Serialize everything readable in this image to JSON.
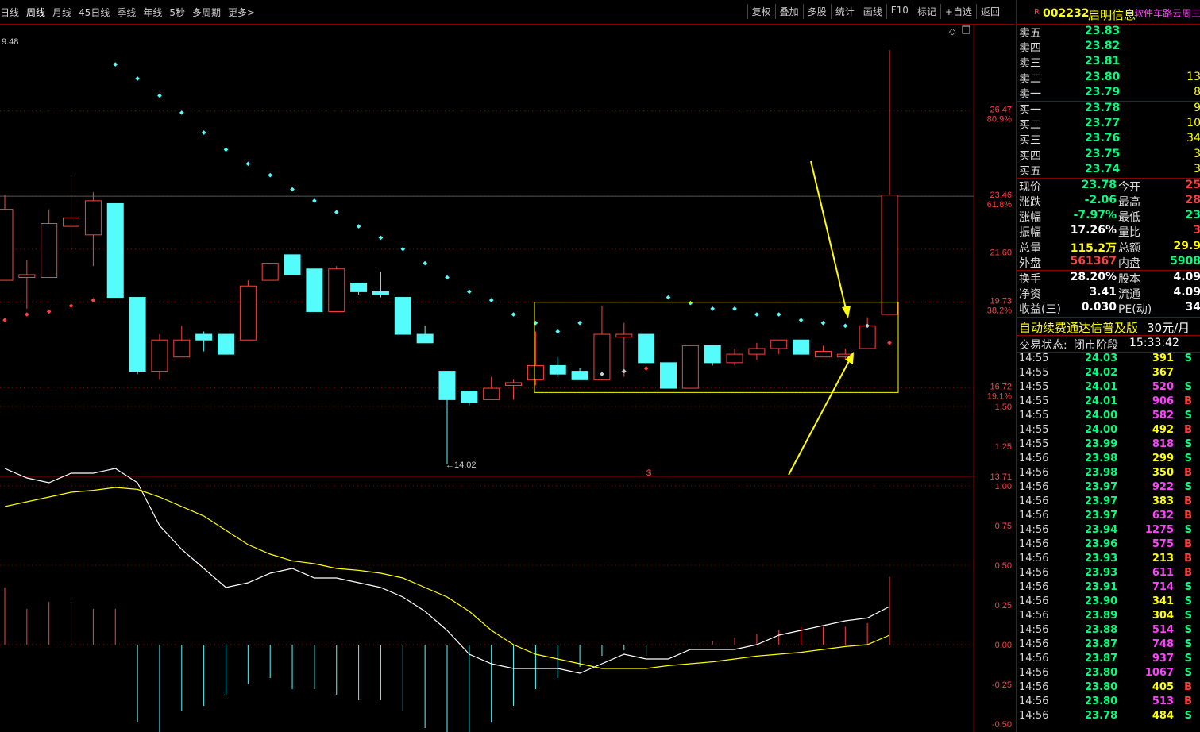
{
  "toolbar": {
    "periods": [
      "日线",
      "周线",
      "月线",
      "45日线",
      "季线",
      "年线",
      "5秒",
      "多周期",
      "更多>"
    ],
    "active_period": "周线",
    "actions": [
      "复权",
      "叠加",
      "多股",
      "统计",
      "画线",
      "F10",
      "标记",
      "+自选",
      "返回"
    ]
  },
  "chart_data": {
    "type": "candlestick",
    "price_axis_labels": [
      "26.47",
      "80.9%",
      "23.46",
      "61.8%",
      "21.60",
      "19.73",
      "38.2%",
      "16.72",
      "19.1%",
      "13.71"
    ],
    "top_left_label": "9.48",
    "low_marker": "14.02",
    "marker_symbol": "$",
    "macd_axis_labels": [
      "1.50",
      "1.25",
      "1.00",
      "0.75",
      "0.50",
      "0.25",
      "0.00",
      "-0.25",
      "-0.50"
    ],
    "candles": [
      {
        "o": 20.5,
        "h": 23.5,
        "l": 20.5,
        "c": 23.0
      },
      {
        "o": 20.6,
        "h": 21.2,
        "l": 19.5,
        "c": 20.7
      },
      {
        "o": 20.6,
        "h": 23.0,
        "l": 20.6,
        "c": 22.5
      },
      {
        "o": 22.4,
        "h": 24.2,
        "l": 21.5,
        "c": 22.7
      },
      {
        "o": 22.1,
        "h": 23.6,
        "l": 21.0,
        "c": 23.3
      },
      {
        "o": 23.2,
        "h": 23.2,
        "l": 19.9,
        "c": 19.9
      },
      {
        "o": 19.9,
        "h": 19.9,
        "l": 17.2,
        "c": 17.3
      },
      {
        "o": 17.3,
        "h": 18.6,
        "l": 17.0,
        "c": 18.4
      },
      {
        "o": 17.8,
        "h": 18.9,
        "l": 17.8,
        "c": 18.4
      },
      {
        "o": 18.6,
        "h": 18.7,
        "l": 18.0,
        "c": 18.4
      },
      {
        "o": 18.6,
        "h": 18.6,
        "l": 17.9,
        "c": 17.9
      },
      {
        "o": 18.4,
        "h": 20.5,
        "l": 18.4,
        "c": 20.3
      },
      {
        "o": 20.5,
        "h": 21.1,
        "l": 20.5,
        "c": 21.1
      },
      {
        "o": 21.4,
        "h": 21.4,
        "l": 20.7,
        "c": 20.7
      },
      {
        "o": 20.9,
        "h": 20.9,
        "l": 19.4,
        "c": 19.4
      },
      {
        "o": 19.4,
        "h": 21.0,
        "l": 19.4,
        "c": 20.9
      },
      {
        "o": 20.4,
        "h": 20.4,
        "l": 20.0,
        "c": 20.1
      },
      {
        "o": 20.1,
        "h": 20.8,
        "l": 19.9,
        "c": 20.0
      },
      {
        "o": 19.9,
        "h": 19.9,
        "l": 18.6,
        "c": 18.6
      },
      {
        "o": 18.6,
        "h": 18.9,
        "l": 18.3,
        "c": 18.3
      },
      {
        "o": 17.3,
        "h": 17.3,
        "l": 14.02,
        "c": 16.3
      },
      {
        "o": 16.6,
        "h": 16.6,
        "l": 16.1,
        "c": 16.2
      },
      {
        "o": 16.3,
        "h": 17.1,
        "l": 16.3,
        "c": 16.7
      },
      {
        "o": 16.8,
        "h": 17.0,
        "l": 16.3,
        "c": 16.9
      },
      {
        "o": 17.0,
        "h": 18.7,
        "l": 16.8,
        "c": 17.5
      },
      {
        "o": 17.5,
        "h": 17.8,
        "l": 17.1,
        "c": 17.2
      },
      {
        "o": 17.3,
        "h": 17.4,
        "l": 17.0,
        "c": 17.0
      },
      {
        "o": 17.0,
        "h": 19.6,
        "l": 17.0,
        "c": 18.6
      },
      {
        "o": 18.5,
        "h": 19.0,
        "l": 17.1,
        "c": 18.6
      },
      {
        "o": 18.6,
        "h": 18.6,
        "l": 17.7,
        "c": 17.6
      },
      {
        "o": 17.6,
        "h": 17.6,
        "l": 16.7,
        "c": 16.7
      },
      {
        "o": 16.7,
        "h": 18.0,
        "l": 16.7,
        "c": 18.2
      },
      {
        "o": 18.2,
        "h": 18.2,
        "l": 17.5,
        "c": 17.6
      },
      {
        "o": 17.6,
        "h": 18.1,
        "l": 17.5,
        "c": 17.9
      },
      {
        "o": 17.9,
        "h": 18.3,
        "l": 17.7,
        "c": 18.1
      },
      {
        "o": 18.1,
        "h": 18.4,
        "l": 17.9,
        "c": 18.4
      },
      {
        "o": 18.4,
        "h": 18.3,
        "l": 17.9,
        "c": 17.9
      },
      {
        "o": 17.8,
        "h": 18.2,
        "l": 17.8,
        "c": 18.0
      },
      {
        "o": 17.8,
        "h": 18.1,
        "l": 17.7,
        "c": 17.9
      },
      {
        "o": 18.1,
        "h": 19.2,
        "l": 18.1,
        "c": 18.9
      },
      {
        "o": 19.3,
        "h": 28.6,
        "l": 19.3,
        "c": 23.5
      }
    ],
    "sar_dots": [
      {
        "i": 0,
        "v": 19.1
      },
      {
        "i": 1,
        "v": 19.3
      },
      {
        "i": 2,
        "v": 19.4
      },
      {
        "i": 3,
        "v": 19.6
      },
      {
        "i": 4,
        "v": 19.8
      },
      {
        "i": 5,
        "v": 28.1
      },
      {
        "i": 6,
        "v": 27.6
      },
      {
        "i": 7,
        "v": 27.0
      },
      {
        "i": 8,
        "v": 26.4
      },
      {
        "i": 9,
        "v": 25.7
      },
      {
        "i": 10,
        "v": 25.1
      },
      {
        "i": 11,
        "v": 24.6
      },
      {
        "i": 12,
        "v": 24.2
      },
      {
        "i": 13,
        "v": 23.7
      },
      {
        "i": 14,
        "v": 23.3
      },
      {
        "i": 15,
        "v": 22.9
      },
      {
        "i": 16,
        "v": 22.4
      },
      {
        "i": 17,
        "v": 22.0
      },
      {
        "i": 18,
        "v": 21.6
      },
      {
        "i": 19,
        "v": 21.1
      },
      {
        "i": 20,
        "v": 20.6
      },
      {
        "i": 21,
        "v": 20.1
      },
      {
        "i": 22,
        "v": 19.8
      },
      {
        "i": 23,
        "v": 19.3
      },
      {
        "i": 24,
        "v": 19.0
      },
      {
        "i": 25,
        "v": 18.7
      },
      {
        "i": 26,
        "v": 19.0
      },
      {
        "i": 27,
        "v": 17.2
      },
      {
        "i": 28,
        "v": 17.3
      },
      {
        "i": 29,
        "v": 17.4
      },
      {
        "i": 30,
        "v": 19.9
      },
      {
        "i": 31,
        "v": 19.7
      },
      {
        "i": 32,
        "v": 19.5
      },
      {
        "i": 33,
        "v": 19.5
      },
      {
        "i": 34,
        "v": 19.3
      },
      {
        "i": 35,
        "v": 19.3
      },
      {
        "i": 36,
        "v": 19.1
      },
      {
        "i": 37,
        "v": 19.0
      },
      {
        "i": 38,
        "v": 18.9
      },
      {
        "i": 39,
        "v": 18.9
      },
      {
        "i": 40,
        "v": 18.3
      }
    ],
    "macd_hist": [
      0.8,
      0.5,
      0.6,
      0.6,
      0.5,
      0.5,
      0.0,
      0.0,
      0.0,
      0.0,
      0.0,
      0.0,
      0.0,
      0.0,
      0.0,
      0.0,
      0.0,
      0.0,
      0.0,
      0.0,
      0.0,
      0.0,
      0.0,
      0.0,
      0.0,
      0.0,
      0.0,
      0.0,
      0.0,
      0.0,
      0.0,
      0.0,
      0.05,
      0.1,
      0.15,
      0.2,
      0.25,
      0.25,
      0.25,
      0.3,
      0.95
    ],
    "macd_hist_neg": [
      0,
      0,
      0,
      0,
      0,
      0,
      -0.7,
      -0.85,
      -0.6,
      -0.55,
      -0.45,
      -0.35,
      -0.3,
      -0.4,
      -0.4,
      -0.45,
      -0.5,
      -0.5,
      -0.6,
      -0.75,
      -0.9,
      -0.8,
      -0.7,
      -0.55,
      -0.4,
      -0.3,
      -0.2,
      -0.1,
      -0.05,
      -0.1,
      0,
      0,
      0,
      0,
      0,
      0,
      0,
      0,
      0,
      0,
      0
    ],
    "dif": [
      1.85,
      1.75,
      1.7,
      1.8,
      1.8,
      1.85,
      1.7,
      1.25,
      1.0,
      0.8,
      0.6,
      0.65,
      0.75,
      0.8,
      0.7,
      0.7,
      0.65,
      0.6,
      0.5,
      0.35,
      0.15,
      -0.1,
      -0.2,
      -0.25,
      -0.25,
      -0.25,
      -0.3,
      -0.2,
      -0.1,
      -0.15,
      -0.15,
      -0.05,
      -0.05,
      -0.05,
      0.0,
      0.1,
      0.15,
      0.2,
      0.25,
      0.28,
      0.4
    ],
    "dea": [
      1.45,
      1.5,
      1.55,
      1.6,
      1.62,
      1.65,
      1.63,
      1.55,
      1.45,
      1.35,
      1.2,
      1.05,
      0.95,
      0.88,
      0.85,
      0.8,
      0.78,
      0.75,
      0.7,
      0.6,
      0.5,
      0.35,
      0.15,
      0.0,
      -0.1,
      -0.15,
      -0.2,
      -0.25,
      -0.25,
      -0.25,
      -0.22,
      -0.2,
      -0.18,
      -0.15,
      -0.12,
      -0.1,
      -0.08,
      -0.05,
      -0.02,
      0.0,
      0.1
    ]
  },
  "stock": {
    "flag": "R",
    "code": "002232",
    "name": "启明信息",
    "tag": "软件车路云周三"
  },
  "order_book": {
    "asks": [
      {
        "label": "卖五",
        "price": "23.83",
        "vol": ""
      },
      {
        "label": "卖四",
        "price": "23.82",
        "vol": ""
      },
      {
        "label": "卖三",
        "price": "23.81",
        "vol": ""
      },
      {
        "label": "卖二",
        "price": "23.80",
        "vol": "13"
      },
      {
        "label": "卖一",
        "price": "23.79",
        "vol": "8"
      }
    ],
    "bids": [
      {
        "label": "买一",
        "price": "23.78",
        "vol": "9"
      },
      {
        "label": "买二",
        "price": "23.77",
        "vol": "10"
      },
      {
        "label": "买三",
        "price": "23.76",
        "vol": "34"
      },
      {
        "label": "买四",
        "price": "23.75",
        "vol": "3"
      },
      {
        "label": "买五",
        "price": "23.74",
        "vol": "3"
      }
    ]
  },
  "quote": [
    {
      "l1": "现价",
      "v1": "23.78",
      "c1": "green",
      "l2": "今开",
      "v2": "25",
      "c2": "red"
    },
    {
      "l1": "涨跌",
      "v1": "-2.06",
      "c1": "green",
      "l2": "最高",
      "v2": "28",
      "c2": "red"
    },
    {
      "l1": "涨幅",
      "v1": "-7.97%",
      "c1": "green",
      "l2": "最低",
      "v2": "23",
      "c2": "green"
    },
    {
      "l1": "振幅",
      "v1": "17.26%",
      "c1": "white",
      "l2": "量比",
      "v2": "3",
      "c2": "red"
    },
    {
      "l1": "总量",
      "v1": "115.2万",
      "c1": "yellow",
      "l2": "总额",
      "v2": "29.9",
      "c2": "yellow"
    },
    {
      "l1": "外盘",
      "v1": "561367",
      "c1": "red",
      "l2": "内盘",
      "v2": "5908",
      "c2": "green"
    }
  ],
  "fundamentals": [
    {
      "l1": "换手",
      "v1": "28.20%",
      "l2": "股本",
      "v2": "4.09"
    },
    {
      "l1": "净资",
      "v1": "3.41",
      "l2": "流通",
      "v2": "4.09"
    },
    {
      "l1": "收益(三)",
      "v1": "0.030",
      "l2": "PE(动)",
      "v2": "34"
    }
  ],
  "promo": {
    "text": "自动续费通达信普及版",
    "price": "30元/月"
  },
  "trade_state": {
    "label": "交易状态:",
    "value": "闭市阶段",
    "time": "15:33:42"
  },
  "ticks": [
    {
      "t": "14:55",
      "p": "24.03",
      "v": "391",
      "vc": "yellow",
      "bs": "S"
    },
    {
      "t": "14:55",
      "p": "24.02",
      "v": "367",
      "vc": "yellow",
      "bs": ""
    },
    {
      "t": "14:55",
      "p": "24.01",
      "v": "520",
      "vc": "magenta",
      "bs": "S"
    },
    {
      "t": "14:55",
      "p": "24.01",
      "v": "906",
      "vc": "magenta",
      "bs": "B"
    },
    {
      "t": "14:55",
      "p": "24.00",
      "v": "582",
      "vc": "magenta",
      "bs": "S"
    },
    {
      "t": "14:55",
      "p": "24.00",
      "v": "492",
      "vc": "yellow",
      "bs": "B"
    },
    {
      "t": "14:55",
      "p": "23.99",
      "v": "818",
      "vc": "magenta",
      "bs": "S"
    },
    {
      "t": "14:56",
      "p": "23.98",
      "v": "299",
      "vc": "yellow",
      "bs": "S"
    },
    {
      "t": "14:56",
      "p": "23.98",
      "v": "350",
      "vc": "yellow",
      "bs": "B"
    },
    {
      "t": "14:56",
      "p": "23.97",
      "v": "922",
      "vc": "magenta",
      "bs": "S"
    },
    {
      "t": "14:56",
      "p": "23.97",
      "v": "383",
      "vc": "yellow",
      "bs": "B"
    },
    {
      "t": "14:56",
      "p": "23.97",
      "v": "632",
      "vc": "magenta",
      "bs": "B"
    },
    {
      "t": "14:56",
      "p": "23.94",
      "v": "1275",
      "vc": "magenta",
      "bs": "S"
    },
    {
      "t": "14:56",
      "p": "23.96",
      "v": "575",
      "vc": "magenta",
      "bs": "B"
    },
    {
      "t": "14:56",
      "p": "23.93",
      "v": "213",
      "vc": "yellow",
      "bs": "B"
    },
    {
      "t": "14:56",
      "p": "23.93",
      "v": "611",
      "vc": "magenta",
      "bs": "B"
    },
    {
      "t": "14:56",
      "p": "23.91",
      "v": "714",
      "vc": "magenta",
      "bs": "S"
    },
    {
      "t": "14:56",
      "p": "23.90",
      "v": "341",
      "vc": "yellow",
      "bs": "S"
    },
    {
      "t": "14:56",
      "p": "23.89",
      "v": "304",
      "vc": "yellow",
      "bs": "S"
    },
    {
      "t": "14:56",
      "p": "23.88",
      "v": "514",
      "vc": "magenta",
      "bs": "S"
    },
    {
      "t": "14:56",
      "p": "23.87",
      "v": "748",
      "vc": "magenta",
      "bs": "S"
    },
    {
      "t": "14:56",
      "p": "23.87",
      "v": "937",
      "vc": "magenta",
      "bs": "S"
    },
    {
      "t": "14:56",
      "p": "23.80",
      "v": "1067",
      "vc": "magenta",
      "bs": "S"
    },
    {
      "t": "14:56",
      "p": "23.80",
      "v": "405",
      "vc": "yellow",
      "bs": "B"
    },
    {
      "t": "14:56",
      "p": "23.80",
      "v": "513",
      "vc": "magenta",
      "bs": "B"
    },
    {
      "t": "14:56",
      "p": "23.78",
      "v": "484",
      "vc": "yellow",
      "bs": "S"
    }
  ],
  "colors": {
    "up": "#ff4040",
    "down": "#54fcfc",
    "grid": "#8b0000",
    "highlight": "#ffff00"
  }
}
